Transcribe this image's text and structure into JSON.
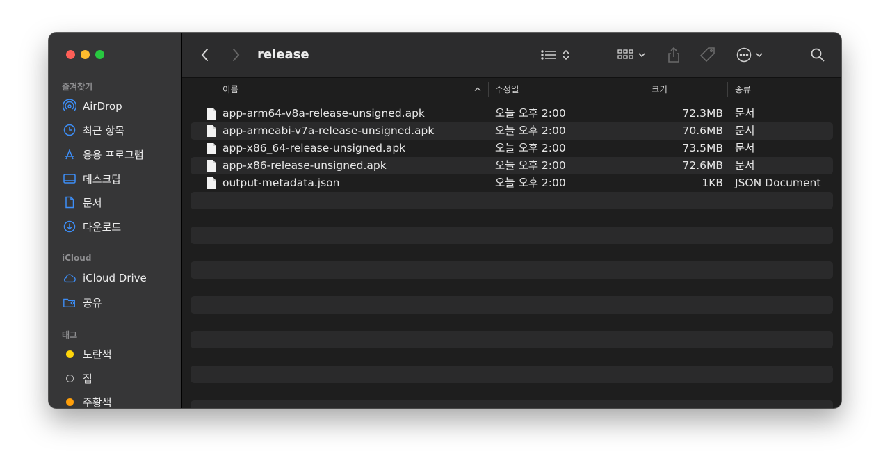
{
  "window": {
    "title": "release"
  },
  "sidebar": {
    "sections": [
      {
        "label": "즐겨찾기",
        "items": [
          {
            "label": "AirDrop",
            "icon": "airdrop-icon"
          },
          {
            "label": "최근 항목",
            "icon": "clock-icon"
          },
          {
            "label": "응용 프로그램",
            "icon": "applications-icon"
          },
          {
            "label": "데스크탑",
            "icon": "desktop-icon"
          },
          {
            "label": "문서",
            "icon": "document-icon"
          },
          {
            "label": "다운로드",
            "icon": "download-icon"
          }
        ]
      },
      {
        "label": "iCloud",
        "items": [
          {
            "label": "iCloud Drive",
            "icon": "cloud-icon"
          },
          {
            "label": "공유",
            "icon": "shared-folder-icon"
          }
        ]
      },
      {
        "label": "태그",
        "items": [
          {
            "label": "노란색",
            "color": "#ffd60a"
          },
          {
            "label": "집",
            "color": "none"
          },
          {
            "label": "주황색",
            "color": "#ff9f0a"
          }
        ]
      }
    ]
  },
  "columns": {
    "name": "이름",
    "modified": "수정일",
    "size": "크기",
    "kind": "종류"
  },
  "files": [
    {
      "name": "app-arm64-v8a-release-unsigned.apk",
      "modified": "오늘 오후 2:00",
      "size": "72.3MB",
      "kind": "문서"
    },
    {
      "name": "app-armeabi-v7a-release-unsigned.apk",
      "modified": "오늘 오후 2:00",
      "size": "70.6MB",
      "kind": "문서"
    },
    {
      "name": "app-x86_64-release-unsigned.apk",
      "modified": "오늘 오후 2:00",
      "size": "73.5MB",
      "kind": "문서"
    },
    {
      "name": "app-x86-release-unsigned.apk",
      "modified": "오늘 오후 2:00",
      "size": "72.6MB",
      "kind": "문서"
    },
    {
      "name": "output-metadata.json",
      "modified": "오늘 오후 2:00",
      "size": "1KB",
      "kind": "JSON Document"
    }
  ],
  "colors": {
    "sidebar_bg": "#363637",
    "content_bg": "#1e1e1e",
    "accent": "#3d8ef7"
  }
}
